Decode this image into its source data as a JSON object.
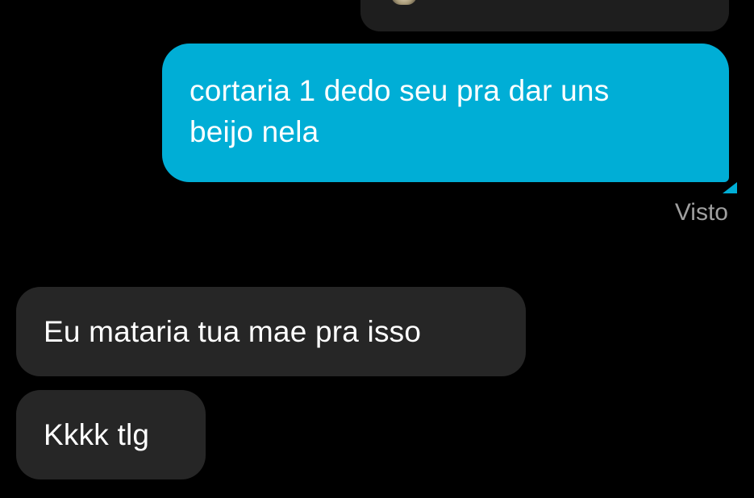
{
  "colors": {
    "background": "#000000",
    "sent_bubble": "#00aed6",
    "received_bubble": "#262626",
    "seen_text": "#a0a0a0",
    "message_text": "#ffffff"
  },
  "thread": {
    "shared_media": {
      "icon": "media-thumbnail"
    },
    "sent_message": {
      "text": "cortaria 1 dedo seu pra dar uns\nbeijo nela",
      "status": "Visto"
    },
    "received_messages": [
      {
        "text": "Eu mataria tua mae pra isso"
      },
      {
        "text": "Kkkk tlg"
      }
    ]
  }
}
